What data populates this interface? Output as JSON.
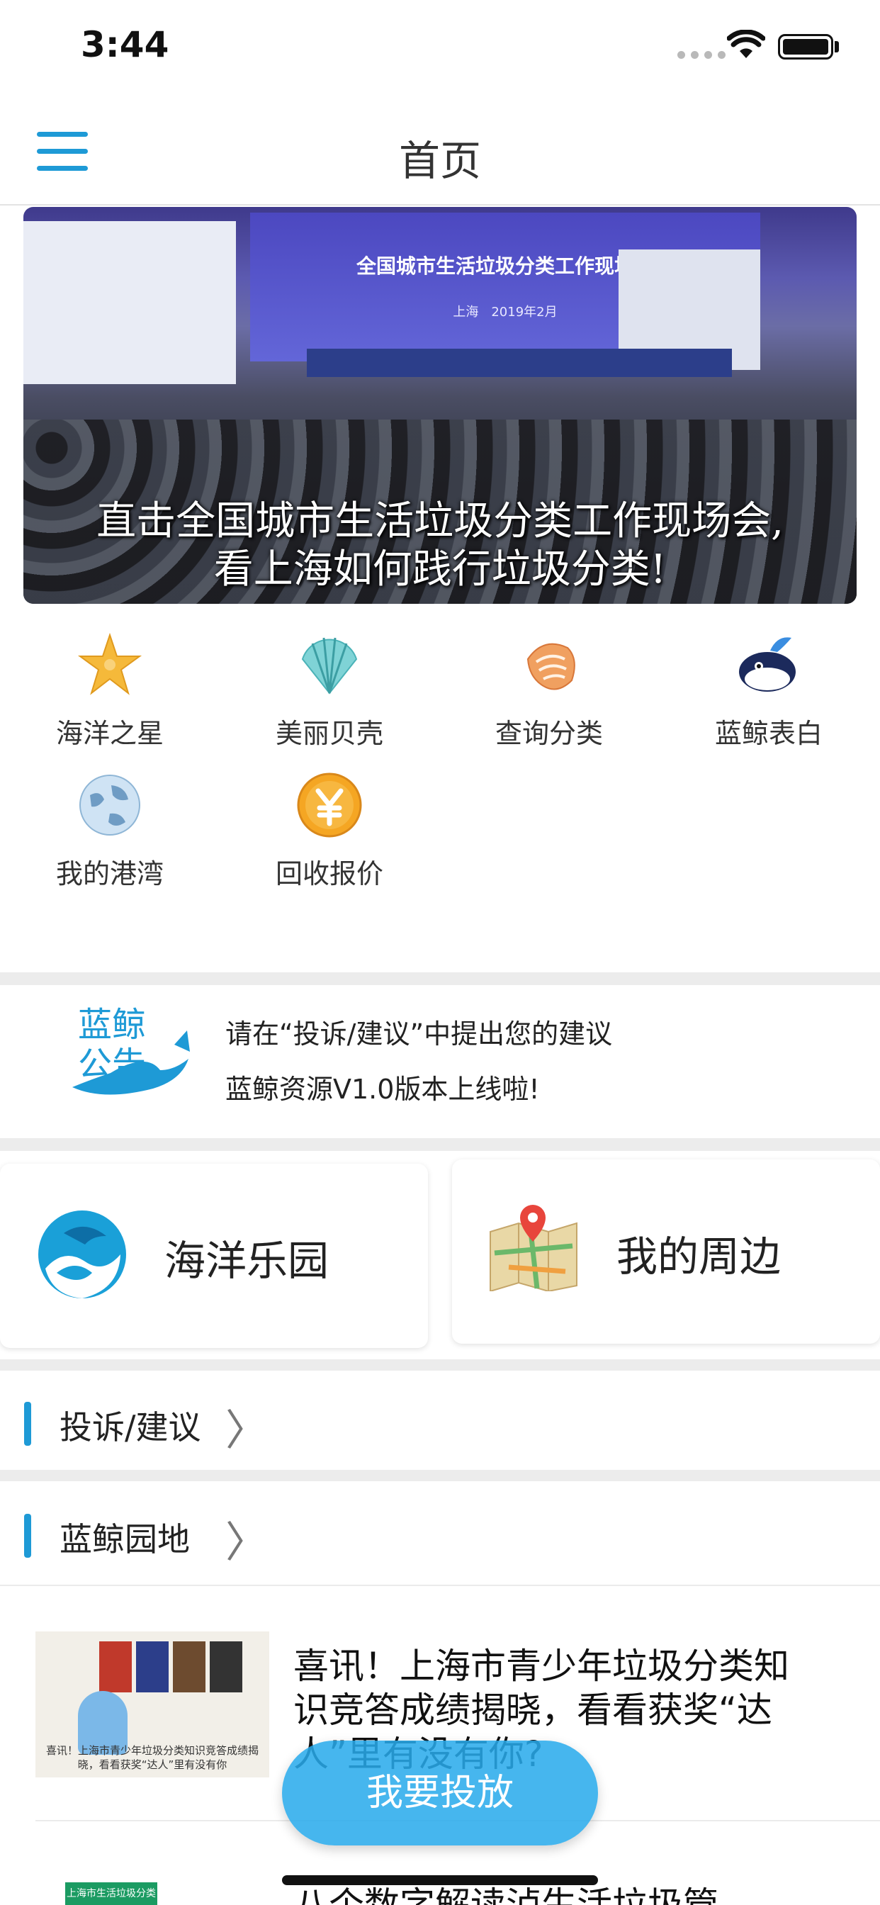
{
  "status_bar": {
    "time": "3:44"
  },
  "nav": {
    "title": "首页"
  },
  "banner": {
    "screen_title": "全国城市生活垃圾分类工作现场会",
    "screen_sub": "上海　2019年2月",
    "caption_line1": "直击全国城市生活垃圾分类工作现场会,",
    "caption_line2": "看上海如何践行垃圾分类!"
  },
  "quick_menu": [
    {
      "label": "海洋之星",
      "icon": "starfish-icon"
    },
    {
      "label": "美丽贝壳",
      "icon": "scallop-shell-icon"
    },
    {
      "label": "查询分类",
      "icon": "conch-shell-icon"
    },
    {
      "label": "蓝鲸表白",
      "icon": "whale-icon"
    },
    {
      "label": "我的港湾",
      "icon": "globe-icon"
    },
    {
      "label": "回收报价",
      "icon": "yen-coin-icon"
    }
  ],
  "notice": {
    "logo_text_1": "蓝鲸",
    "logo_text_2": "公告",
    "line1": "请在“投诉/建议”中提出您的建议",
    "line2": "蓝鲸资源V1.0版本上线啦!"
  },
  "features": {
    "ocean_park": "海洋乐园",
    "nearby": "我的周边"
  },
  "sections": {
    "complaint": "投诉/建议",
    "garden": "蓝鲸园地",
    "chevron": "〉"
  },
  "news": [
    {
      "title": "喜讯！上海市青少年垃圾分类知识竞答成绩揭晓，看看获奖“达人”里有没有你?",
      "thumb_caption": "喜讯！上海市青少年垃圾分类知识竞答成绩揭晓，看看获奖“达人”里有没有你"
    },
    {
      "title": "八个数字解读泸生活垃圾管",
      "thumb_caption": "上海市生活垃圾分类标识"
    }
  ],
  "deliver_button": "我要投放",
  "colors": {
    "accent": "#1e9ad6",
    "button": "#28aaeb"
  }
}
